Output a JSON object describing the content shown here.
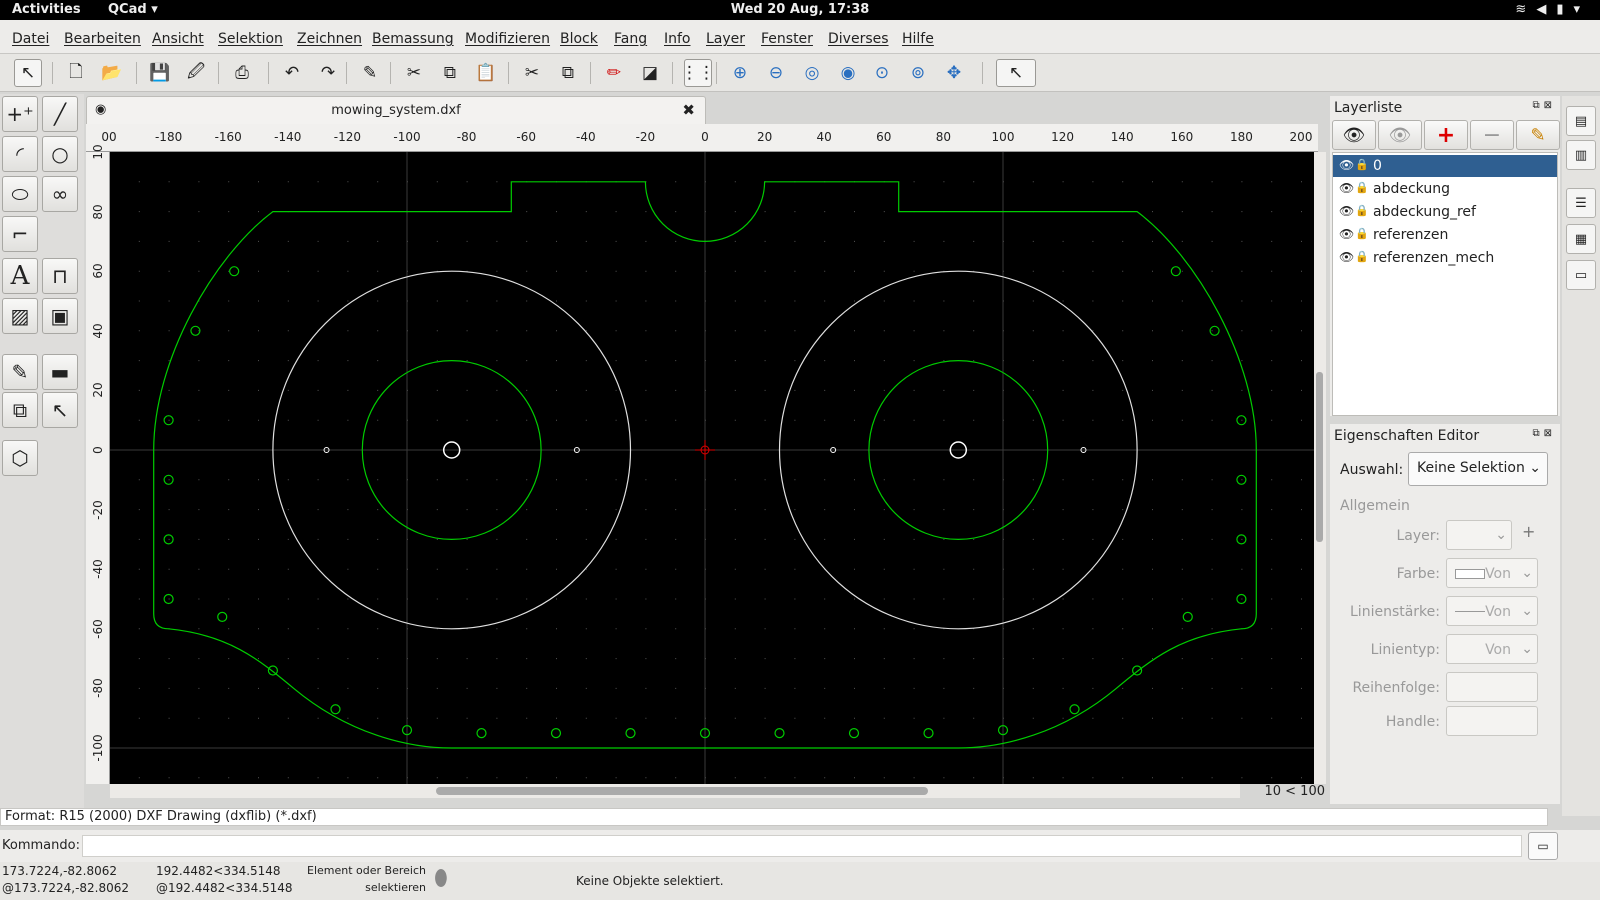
{
  "topbar": {
    "activities": "Activities",
    "app_menu": "QCad ▾",
    "clock": "Wed 20 Aug, 17:38"
  },
  "menubar": {
    "items": [
      "Datei",
      "Bearbeiten",
      "Ansicht",
      "Selektion",
      "Zeichnen",
      "Bemassung",
      "Modifizieren",
      "Block",
      "Fang",
      "Info",
      "Layer",
      "Fenster",
      "Diverses",
      "Hilfe"
    ]
  },
  "toolbar": {
    "icons": [
      "select-arrow-icon",
      "new-file-icon",
      "open-file-icon",
      "save-icon",
      "save-as-icon",
      "print-icon",
      "undo-icon",
      "redo-icon",
      "pen-icon",
      "cut-icon",
      "copy-icon",
      "paste-icon",
      "cut-ref-icon",
      "copy-ref-icon",
      "red-pen-icon",
      "preview-icon",
      "grid-icon",
      "zoom-in-icon",
      "zoom-out-icon",
      "zoom-auto-icon",
      "zoom-previous-icon",
      "zoom-window-icon",
      "zoom-selection-icon",
      "pan-icon",
      "pointer-icon"
    ]
  },
  "document": {
    "tab_title": "mowing_system.dxf",
    "close_glyph": "✖"
  },
  "ruler": {
    "x_ticks": [
      "00",
      "-180",
      "-160",
      "-140",
      "-120",
      "-100",
      "-80",
      "-60",
      "-40",
      "-20",
      "0",
      "20",
      "40",
      "60",
      "80",
      "100",
      "120",
      "140",
      "160",
      "180",
      "200"
    ],
    "y_ticks": [
      "10",
      "80",
      "60",
      "40",
      "20",
      "0",
      "-20",
      "-40",
      "-60",
      "-80",
      "-100"
    ]
  },
  "zoom_label": "10 < 100",
  "layers": {
    "title": "Layerliste",
    "items": [
      {
        "name": "0",
        "selected": true
      },
      {
        "name": "abdeckung",
        "selected": false
      },
      {
        "name": "abdeckung_ref",
        "selected": false
      },
      {
        "name": "referenzen",
        "selected": false
      },
      {
        "name": "referenzen_mech",
        "selected": false
      }
    ]
  },
  "properties": {
    "title": "Eigenschaften Editor",
    "selection_label": "Auswahl:",
    "selection_value": "Keine Selektion",
    "section": "Allgemein",
    "fields": [
      {
        "label": "Layer:",
        "value": ""
      },
      {
        "label": "Farbe:",
        "value": "Von"
      },
      {
        "label": "Linienstärke:",
        "value": "Von"
      },
      {
        "label": "Linientyp:",
        "value": "Von"
      },
      {
        "label": "Reihenfolge:",
        "value": ""
      },
      {
        "label": "Handle:",
        "value": ""
      }
    ]
  },
  "format_line": "Format: R15 (2000) DXF Drawing (dxflib) (*.dxf)",
  "command": {
    "label": "Kommando:",
    "value": ""
  },
  "status": {
    "abs_coord": "173.7224,-82.8062",
    "rel_coord": "@173.7224,-82.8062",
    "polar_coord": "192.4482<334.5148",
    "rel_polar_coord": "@192.4482<334.5148",
    "mouse_hint_1": "Element oder Bereich",
    "mouse_hint_2": "selektieren",
    "selection_info": "Keine Objekte selektiert."
  },
  "colors": {
    "canvas_bg": "#000000",
    "outline": "#00cc00",
    "circle_white": "#e0e0e0",
    "selection_blue": "#2f5f91"
  }
}
